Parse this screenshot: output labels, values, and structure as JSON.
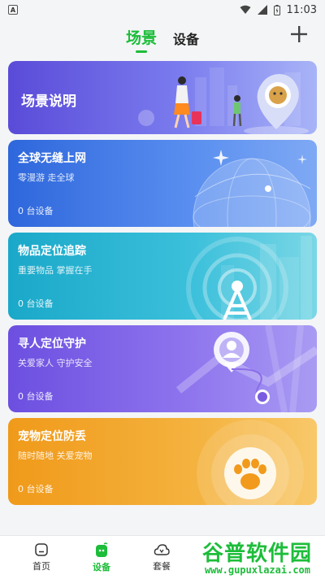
{
  "status_bar": {
    "app_icon_letter": "A",
    "time": "11:03"
  },
  "header": {
    "tabs": [
      {
        "label": "场景",
        "active": true
      },
      {
        "label": "设备",
        "active": false
      }
    ],
    "add_icon": "plus-icon"
  },
  "cards": {
    "intro": {
      "title": "场景说明"
    },
    "global": {
      "title": "全球无缝上网",
      "subtitle": "零漫游 走全球",
      "count": "0 台设备"
    },
    "item": {
      "title": "物品定位追踪",
      "subtitle": "重要物品 掌握在手",
      "count": "0 台设备"
    },
    "person": {
      "title": "寻人定位守护",
      "subtitle": "关爱家人 守护安全",
      "count": "0 台设备"
    },
    "pet": {
      "title": "宠物定位防丢",
      "subtitle": "随时随地 关爱宠物",
      "count": "0 台设备"
    }
  },
  "bottom_nav": {
    "items": [
      {
        "label": "首页",
        "icon": "home-icon"
      },
      {
        "label": "设备",
        "icon": "device-icon"
      },
      {
        "label": "套餐",
        "icon": "package-icon"
      }
    ]
  },
  "watermark": {
    "brand": "谷普软件园",
    "url": "www.gupuxlazai.com"
  },
  "colors": {
    "accent": "#1dbd3a"
  }
}
